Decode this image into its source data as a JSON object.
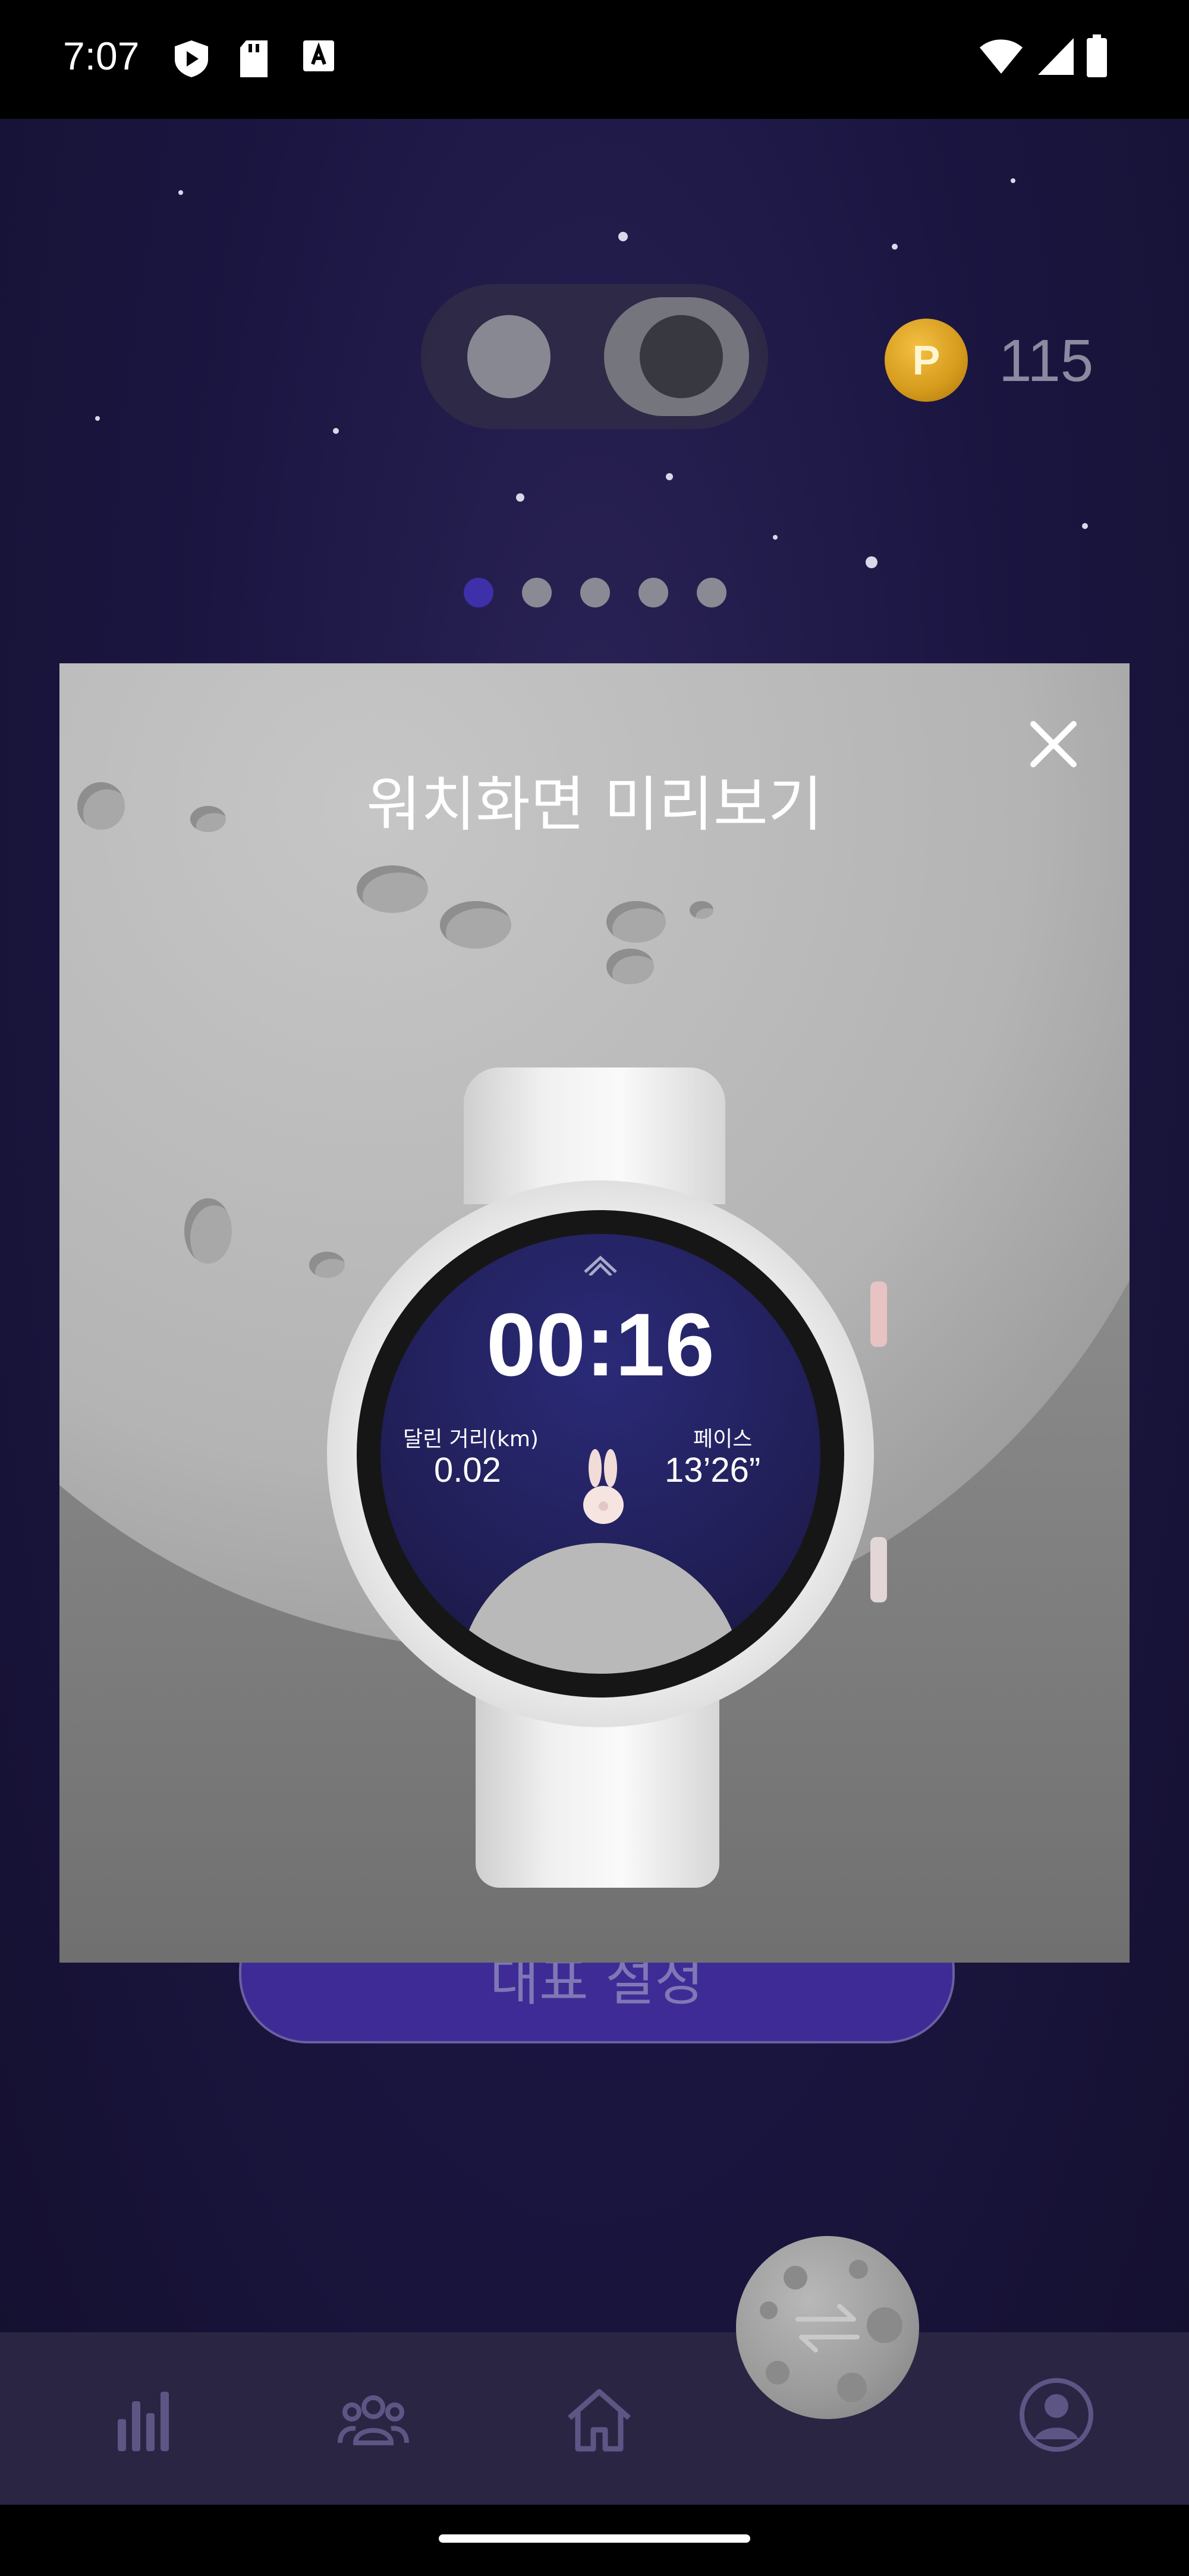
{
  "status_bar": {
    "time": "7:07"
  },
  "header": {
    "points": "115",
    "coin_label": "P"
  },
  "pager": {
    "count": 5,
    "active_index": 0
  },
  "main_button": {
    "label": "대표 설정"
  },
  "modal": {
    "title": "워치화면 미리보기",
    "watch": {
      "elapsed": "00:16",
      "distance_label": "달린 거리(km)",
      "distance_value": "0.02",
      "pace_label": "페이스",
      "pace_value": "13’26”"
    }
  },
  "colors": {
    "pager_active": "#3d30a8",
    "coin": "#d49a1b",
    "watch_face": "#22205a"
  },
  "bottom_nav": {
    "items": [
      "stats-icon",
      "group-icon",
      "home-icon",
      "switch-icon",
      "profile-icon"
    ]
  }
}
